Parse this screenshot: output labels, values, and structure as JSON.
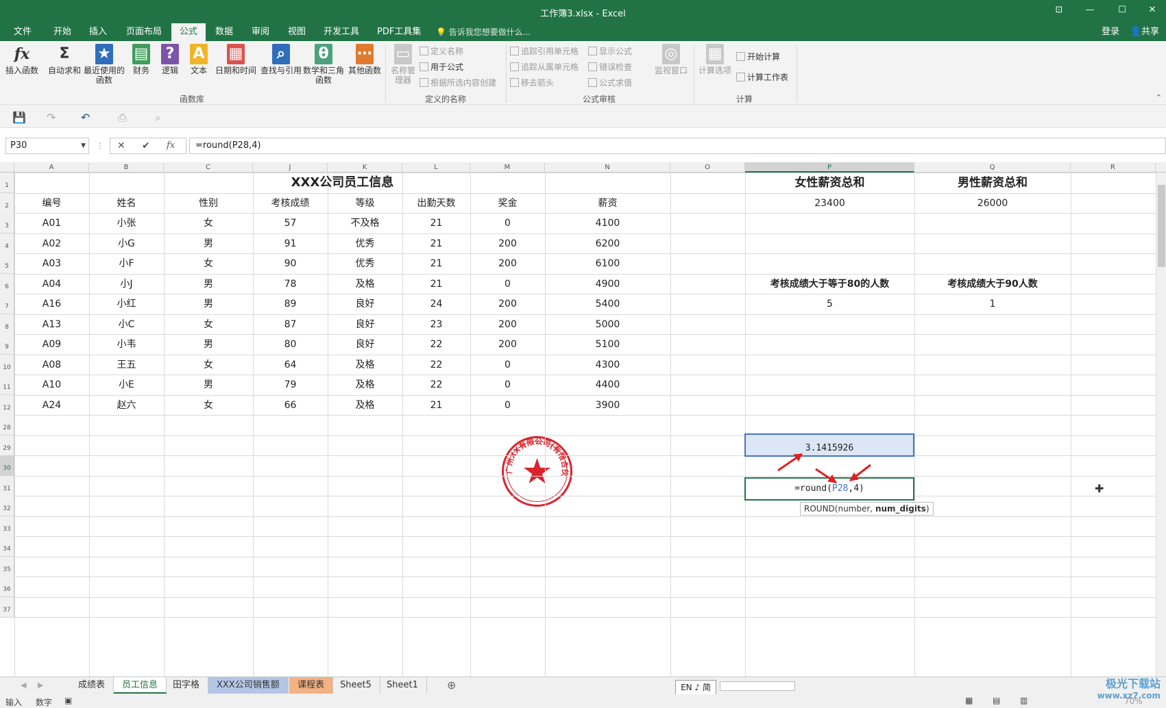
{
  "window": {
    "title": "工作簿3.xlsx - Excel"
  },
  "tabs": [
    "文件",
    "开始",
    "插入",
    "页面布局",
    "公式",
    "数据",
    "审阅",
    "视图",
    "开发工具",
    "PDF工具集"
  ],
  "active_tab": "公式",
  "tell_me": "告诉我您想要做什么...",
  "login": "登录",
  "share": "共享",
  "ribbon": {
    "function_library": {
      "label": "函数库",
      "buttons": [
        "插入函数",
        "自动求和",
        "最近使用的函数",
        "财务",
        "逻辑",
        "文本",
        "日期和时间",
        "查找与引用",
        "数学和三角函数",
        "其他函数"
      ]
    },
    "defined_names": {
      "label": "定义的名称",
      "manager": "名称管理器",
      "items": [
        "定义名称",
        "用于公式",
        "根据所选内容创建"
      ]
    },
    "formula_auditing": {
      "label": "公式审核",
      "items": [
        "追踪引用单元格",
        "追踪从属单元格",
        "移去箭头",
        "显示公式",
        "错误检查",
        "公式求值"
      ],
      "watch": "监视窗口"
    },
    "calculation": {
      "label": "计算",
      "options": "计算选项",
      "items": [
        "开始计算",
        "计算工作表"
      ]
    }
  },
  "formula_bar": {
    "name_box": "P30",
    "formula": "=round(P28,4)",
    "fx": "fx"
  },
  "columns": [
    "A",
    "B",
    "C",
    "J",
    "K",
    "L",
    "M",
    "N",
    "O",
    "P",
    "Q",
    "R"
  ],
  "rows": [
    "1",
    "2",
    "3",
    "4",
    "5",
    "6",
    "7",
    "8",
    "9",
    "10",
    "11",
    "12",
    "28",
    "29",
    "30",
    "31",
    "32",
    "33",
    "34",
    "35",
    "36",
    "37"
  ],
  "table": {
    "title": "XXX公司员工信息",
    "headers": [
      "编号",
      "姓名",
      "性别",
      "考核成绩",
      "等级",
      "出勤天数",
      "奖金",
      "薪资"
    ],
    "rows": [
      [
        "A01",
        "小张",
        "女",
        "57",
        "不及格",
        "21",
        "0",
        "4100"
      ],
      [
        "A02",
        "小G",
        "男",
        "91",
        "优秀",
        "21",
        "200",
        "6200"
      ],
      [
        "A03",
        "小F",
        "女",
        "90",
        "优秀",
        "21",
        "200",
        "6100"
      ],
      [
        "A04",
        "小J",
        "男",
        "78",
        "及格",
        "21",
        "0",
        "4900"
      ],
      [
        "A16",
        "小红",
        "男",
        "89",
        "良好",
        "24",
        "200",
        "5400"
      ],
      [
        "A13",
        "小C",
        "女",
        "87",
        "良好",
        "23",
        "200",
        "5000"
      ],
      [
        "A09",
        "小韦",
        "男",
        "80",
        "良好",
        "22",
        "200",
        "5100"
      ],
      [
        "A08",
        "王五",
        "女",
        "64",
        "及格",
        "22",
        "0",
        "4300"
      ],
      [
        "A10",
        "小E",
        "男",
        "79",
        "及格",
        "22",
        "0",
        "4400"
      ],
      [
        "A24",
        "赵六",
        "女",
        "66",
        "及格",
        "21",
        "0",
        "3900"
      ]
    ]
  },
  "summary": {
    "female_label": "女性薪资总和",
    "female_value": "23400",
    "male_label": "男性薪资总和",
    "male_value": "26000",
    "ge80_label": "考核成绩大于等于80的人数",
    "ge80_value": "5",
    "gt90_label": "考核成绩大于90人数",
    "gt90_value": "1"
  },
  "p28_value": "3.1415926",
  "p30_edit": {
    "prefix": "=round(",
    "ref": "P28",
    "suffix": ",4)"
  },
  "tooltip": {
    "name": "ROUND(number, ",
    "bold": "num_digits",
    "close": ")"
  },
  "stamp_text": "广州XX有限公司(有限合伙)",
  "sheet_tabs": [
    "成绩表",
    "员工信息",
    "田字格",
    "XXX公司销售额",
    "课程表",
    "Sheet5",
    "Sheet1"
  ],
  "active_sheet": "员工信息",
  "status": {
    "mode": "输入",
    "num": "数字",
    "zoom": "70%"
  },
  "ime": "EN ♪ 简",
  "watermark": {
    "line1": "极光下载站",
    "line2": "www.xz7.com"
  },
  "colors": {
    "accent": "#217346",
    "selection": "#4472c4",
    "arrow": "#e02020",
    "stamp": "#d9232d"
  }
}
